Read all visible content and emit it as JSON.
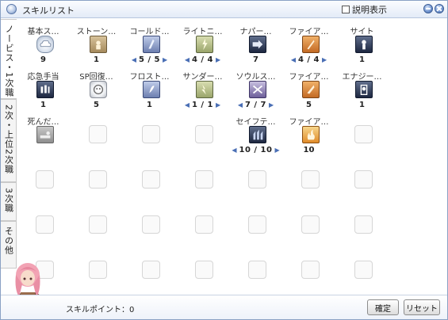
{
  "window": {
    "title": "スキルリスト",
    "description_toggle": {
      "label": "説明表示",
      "checked": false
    }
  },
  "tabs": [
    {
      "label": "ノービス・1次職",
      "active": true
    },
    {
      "label": "2次・上位2次職",
      "active": false
    },
    {
      "label": "3次職",
      "active": false
    },
    {
      "label": "その他",
      "active": false
    }
  ],
  "skills": [
    {
      "row": 0,
      "col": 0,
      "name": "基本ス…",
      "icon": "cloud-icon",
      "level": "9"
    },
    {
      "row": 0,
      "col": 1,
      "name": "ストーン…",
      "icon": "stone-scroll-icon",
      "level": "1"
    },
    {
      "row": 0,
      "col": 2,
      "name": "コールド…",
      "icon": "cold-bolt-icon",
      "level": "5 / 5",
      "arrows": true
    },
    {
      "row": 0,
      "col": 3,
      "name": "ライトニ…",
      "icon": "lightning-bolt-icon",
      "level": "4 / 4",
      "arrows": true
    },
    {
      "row": 0,
      "col": 4,
      "name": "ナパー…",
      "icon": "napalm-beat-icon",
      "level": "7"
    },
    {
      "row": 0,
      "col": 5,
      "name": "ファイア…",
      "icon": "fire-bolt-icon",
      "level": "4 / 4",
      "arrows": true
    },
    {
      "row": 0,
      "col": 6,
      "name": "サイト",
      "icon": "sight-icon",
      "level": "1"
    },
    {
      "row": 1,
      "col": 0,
      "name": "応急手当",
      "icon": "first-aid-icon",
      "level": "1"
    },
    {
      "row": 1,
      "col": 1,
      "name": "SP回復…",
      "icon": "sp-recovery-icon",
      "level": "5"
    },
    {
      "row": 1,
      "col": 2,
      "name": "フロスト…",
      "icon": "frost-diver-icon",
      "level": "1"
    },
    {
      "row": 1,
      "col": 3,
      "name": "サンダー…",
      "icon": "thunder-storm-icon",
      "level": "1 / 1",
      "arrows": true
    },
    {
      "row": 1,
      "col": 4,
      "name": "ソウルス…",
      "icon": "soul-strike-icon",
      "level": "7 / 7",
      "arrows": true
    },
    {
      "row": 1,
      "col": 5,
      "name": "ファイア…",
      "icon": "fire-ball-icon",
      "level": "5"
    },
    {
      "row": 1,
      "col": 6,
      "name": "エナジー…",
      "icon": "energy-coat-icon",
      "level": "1"
    },
    {
      "row": 2,
      "col": 0,
      "name": "死んだ…",
      "icon": "play-dead-icon",
      "level": ""
    },
    {
      "row": 2,
      "col": 4,
      "name": "セイフテ…",
      "icon": "safety-wall-icon",
      "level": "10 / 10",
      "arrows": true
    },
    {
      "row": 2,
      "col": 5,
      "name": "ファイア…",
      "icon": "fire-wall-icon",
      "level": "10"
    }
  ],
  "footer": {
    "skill_points": "スキルポイント：0",
    "confirm_label": "確定",
    "reset_label": "リセット"
  },
  "colors": {
    "title_bar": "#e3ebf7",
    "border": "#8aa1c4",
    "arrow": "#4a6fb5"
  }
}
